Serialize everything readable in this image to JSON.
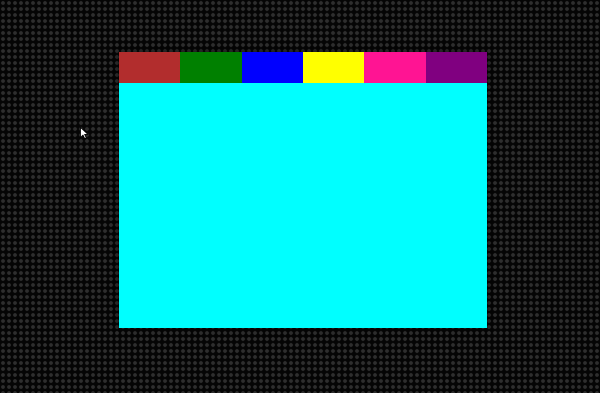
{
  "color_tabs": [
    {
      "name": "brown",
      "color": "#b22d2d"
    },
    {
      "name": "green",
      "color": "#008000"
    },
    {
      "name": "blue",
      "color": "#0000ff"
    },
    {
      "name": "yellow",
      "color": "#ffff00"
    },
    {
      "name": "pink",
      "color": "#ff1493"
    },
    {
      "name": "purple",
      "color": "#800080"
    }
  ],
  "selected_color": {
    "name": "cyan",
    "color": "#00ffff"
  },
  "cursor": {
    "icon": "mouse-pointer-icon"
  }
}
